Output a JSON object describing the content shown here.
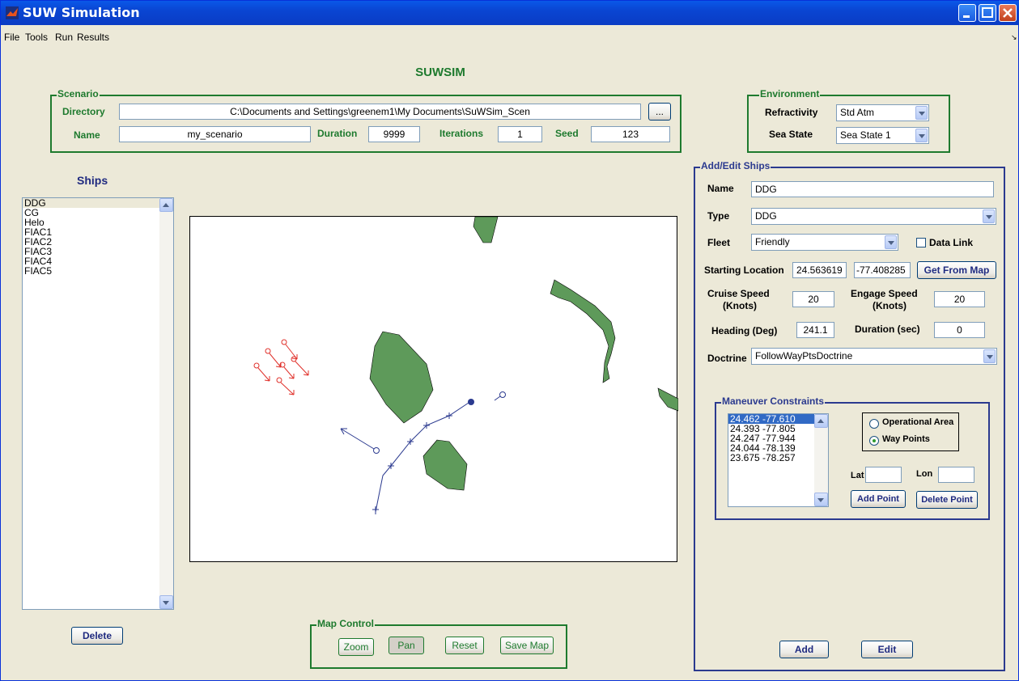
{
  "window": {
    "title": "SUW Simulation",
    "controls": [
      "minimize",
      "maximize",
      "close"
    ]
  },
  "menu": [
    "File",
    "Tools",
    "Run",
    "Results"
  ],
  "app_title": "SUWSIM",
  "scenario": {
    "title": "Scenario",
    "directory_label": "Directory",
    "directory_value": "C:\\Documents and Settings\\greenem1\\My Documents\\SuWSim_Scen",
    "browse_label": "...",
    "name_label": "Name",
    "name_value": "my_scenario",
    "duration_label": "Duration",
    "duration_value": "9999",
    "iterations_label": "Iterations",
    "iterations_value": "1",
    "seed_label": "Seed",
    "seed_value": "123"
  },
  "environment": {
    "title": "Environment",
    "refractivity_label": "Refractivity",
    "refractivity_value": "Std Atm",
    "sea_state_label": "Sea State",
    "sea_state_value": "Sea State 1"
  },
  "ships": {
    "title": "Ships",
    "items": [
      "DDG",
      "CG",
      "Helo",
      "FIAC1",
      "FIAC2",
      "FIAC3",
      "FIAC4",
      "FIAC5"
    ],
    "selected": "DDG",
    "delete_label": "Delete"
  },
  "map_control": {
    "title": "Map Control",
    "zoom_label": "Zoom",
    "pan_label": "Pan",
    "reset_label": "Reset",
    "save_label": "Save Map"
  },
  "add_edit": {
    "title": "Add/Edit Ships",
    "name_label": "Name",
    "name_value": "DDG",
    "type_label": "Type",
    "type_value": "DDG",
    "fleet_label": "Fleet",
    "fleet_value": "Friendly",
    "data_link_label": "Data Link",
    "data_link_checked": false,
    "start_loc_label": "Starting Location",
    "start_lat": "24.563619",
    "start_lon": "-77.408285",
    "get_from_map_label": "Get From Map",
    "cruise_speed_label_1": "Cruise Speed",
    "cruise_speed_label_2": "(Knots)",
    "cruise_speed_value": "20",
    "engage_speed_label_1": "Engage Speed",
    "engage_speed_label_2": "(Knots)",
    "engage_speed_value": "20",
    "heading_label": "Heading (Deg)",
    "heading_value": "241.1",
    "duration_label": "Duration (sec)",
    "duration_value": "0",
    "doctrine_label": "Doctrine",
    "doctrine_value": "FollowWayPtsDoctrine",
    "add_label": "Add",
    "edit_label": "Edit"
  },
  "maneuver": {
    "title": "Maneuver Constraints",
    "points": [
      {
        "lat": "24.462",
        "lon": "-77.610"
      },
      {
        "lat": "24.393",
        "lon": "-77.805"
      },
      {
        "lat": "24.247",
        "lon": "-77.944"
      },
      {
        "lat": "24.044",
        "lon": "-78.139"
      },
      {
        "lat": "23.675",
        "lon": "-78.257"
      }
    ],
    "selected_index": 0,
    "operational_area_label": "Operational Area",
    "way_points_label": "Way Points",
    "mode": "Way Points",
    "lat_label": "Lat",
    "lon_label": "Lon",
    "lat_value": "",
    "lon_value": "",
    "add_point_label": "Add Point",
    "delete_point_label": "Delete Point"
  },
  "colors": {
    "land": "#5e9a5a",
    "friendly_track": "#2b3a8f",
    "hostile": "#e0302a",
    "panel_green": "#1e7a2e"
  }
}
